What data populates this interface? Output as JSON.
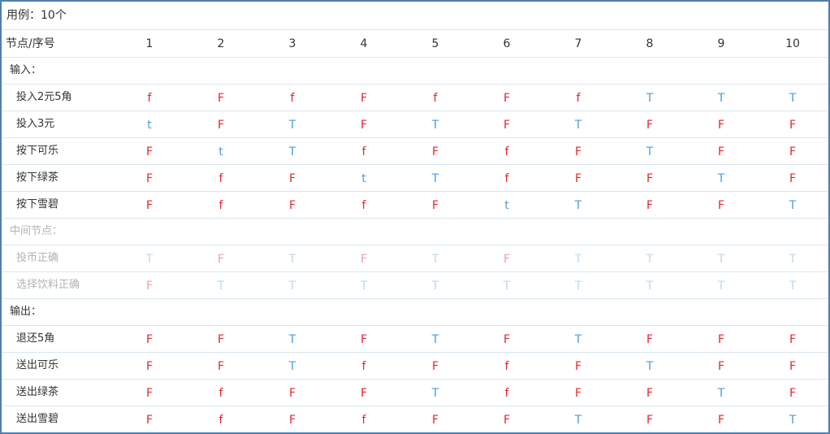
{
  "caption": "用例：10个",
  "header": {
    "label": "节点/序号",
    "columns": [
      "1",
      "2",
      "3",
      "4",
      "5",
      "6",
      "7",
      "8",
      "9",
      "10"
    ]
  },
  "rows": [
    {
      "kind": "section",
      "label": "输入："
    },
    {
      "kind": "data",
      "label": "投入2元5角",
      "values": [
        "f",
        "F",
        "f",
        "F",
        "f",
        "F",
        "f",
        "T",
        "T",
        "T"
      ]
    },
    {
      "kind": "data",
      "label": "投入3元",
      "values": [
        "t",
        "F",
        "T",
        "F",
        "T",
        "F",
        "T",
        "F",
        "F",
        "F"
      ]
    },
    {
      "kind": "data",
      "label": "按下可乐",
      "values": [
        "F",
        "t",
        "T",
        "f",
        "F",
        "f",
        "F",
        "T",
        "F",
        "F"
      ]
    },
    {
      "kind": "data",
      "label": "按下绿茶",
      "values": [
        "F",
        "f",
        "F",
        "t",
        "T",
        "f",
        "F",
        "F",
        "T",
        "F"
      ]
    },
    {
      "kind": "data",
      "label": "按下雪碧",
      "values": [
        "F",
        "f",
        "F",
        "f",
        "F",
        "t",
        "T",
        "F",
        "F",
        "T"
      ]
    },
    {
      "kind": "section",
      "label": "中间节点：",
      "dim": true
    },
    {
      "kind": "data",
      "label": "投币正确",
      "dim": true,
      "values": [
        "T",
        "F",
        "T",
        "F",
        "T",
        "F",
        "T",
        "T",
        "T",
        "T"
      ]
    },
    {
      "kind": "data",
      "label": "选择饮料正确",
      "dim": true,
      "values": [
        "F",
        "T",
        "T",
        "T",
        "T",
        "T",
        "T",
        "T",
        "T",
        "T"
      ]
    },
    {
      "kind": "section",
      "label": "输出："
    },
    {
      "kind": "data",
      "label": "退还5角",
      "values": [
        "F",
        "F",
        "T",
        "F",
        "T",
        "F",
        "T",
        "F",
        "F",
        "F"
      ]
    },
    {
      "kind": "data",
      "label": "送出可乐",
      "values": [
        "F",
        "F",
        "T",
        "f",
        "F",
        "f",
        "F",
        "T",
        "F",
        "F"
      ]
    },
    {
      "kind": "data",
      "label": "送出绿茶",
      "values": [
        "F",
        "f",
        "F",
        "F",
        "T",
        "f",
        "F",
        "F",
        "T",
        "F"
      ]
    },
    {
      "kind": "data",
      "label": "送出雪碧",
      "values": [
        "F",
        "f",
        "F",
        "f",
        "F",
        "F",
        "T",
        "F",
        "F",
        "T"
      ]
    }
  ]
}
